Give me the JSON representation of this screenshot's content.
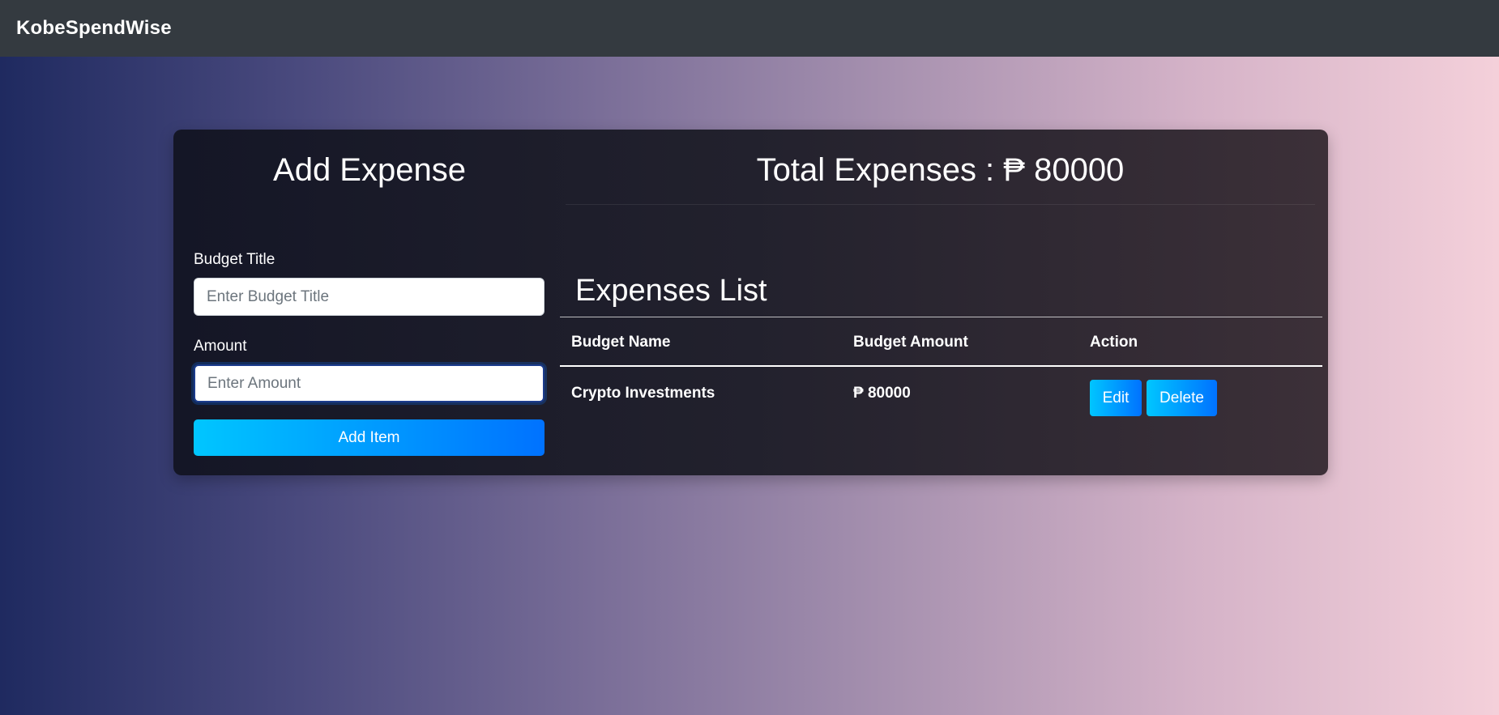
{
  "navbar": {
    "brand": "KobeSpendWise"
  },
  "form": {
    "heading": "Add Expense",
    "title_label": "Budget Title",
    "title_placeholder": "Enter Budget Title",
    "amount_label": "Amount",
    "amount_placeholder": "Enter Amount",
    "submit_label": "Add Item"
  },
  "summary": {
    "total_label": "Total Expenses : ₱ 80000"
  },
  "expenses": {
    "title": "Expenses List",
    "columns": [
      "Budget Name",
      "Budget Amount",
      "Action"
    ],
    "rows": [
      {
        "name": "Crypto Investments",
        "amount": "₱ 80000",
        "edit_label": "Edit",
        "delete_label": "Delete"
      }
    ]
  },
  "colors": {
    "navbar": "#343a40",
    "accent_start": "#00c6ff",
    "accent_end": "#0072ff"
  }
}
